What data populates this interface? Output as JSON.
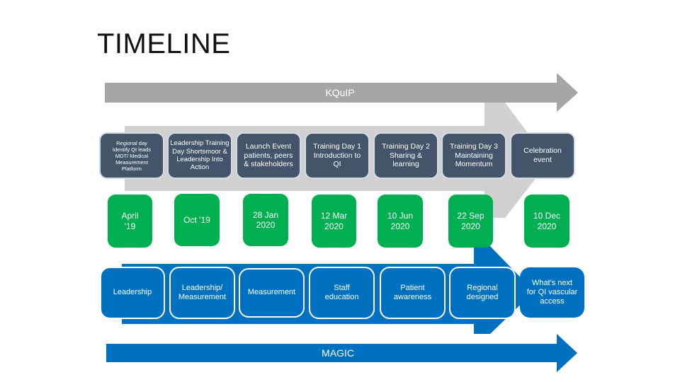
{
  "title": "TIMELINE",
  "colors": {
    "kquip_arrow": "#a6a6a6",
    "kquip_chevron": "#d0d0d0",
    "phase_box": "#44546a",
    "date_box": "#00b050",
    "magic_blue": "#0070c0"
  },
  "top_arrow": {
    "label": "KQuIP"
  },
  "bottom_arrow": {
    "label": "MAGIC"
  },
  "phases": [
    {
      "label": "Regional day\nIdentify QI leads\nMDT/ Medical\nMeasurement\nPlatform"
    },
    {
      "label": "Leadership Training\nDay Shortsmoor &\nLeadership Into\nAction"
    },
    {
      "label": "Launch Event\npatients, peers\n& stakeholders"
    },
    {
      "label": "Training Day 1\nIntroduction to\nQI"
    },
    {
      "label": "Training Day 2\nSharing &\nlearning"
    },
    {
      "label": "Training Day 3\nMaintaining\nMomentum"
    },
    {
      "label": "Celebration\nevent"
    }
  ],
  "dates": [
    {
      "label": "April\n'19"
    },
    {
      "label": "Oct '19"
    },
    {
      "label": "28 Jan\n2020"
    },
    {
      "label": "12 Mar\n2020"
    },
    {
      "label": "10 Jun\n2020"
    },
    {
      "label": "22 Sep\n2020"
    },
    {
      "label": "10 Dec\n2020"
    }
  ],
  "themes": [
    {
      "label": "Leadership"
    },
    {
      "label": "Leadership/\nMeasurement"
    },
    {
      "label": "Measurement"
    },
    {
      "label": "Staff\neducation"
    },
    {
      "label": "Patient\nawareness"
    },
    {
      "label": "Regional\ndesigned"
    },
    {
      "label": "What's next\nfor QI vascular\naccess"
    }
  ]
}
